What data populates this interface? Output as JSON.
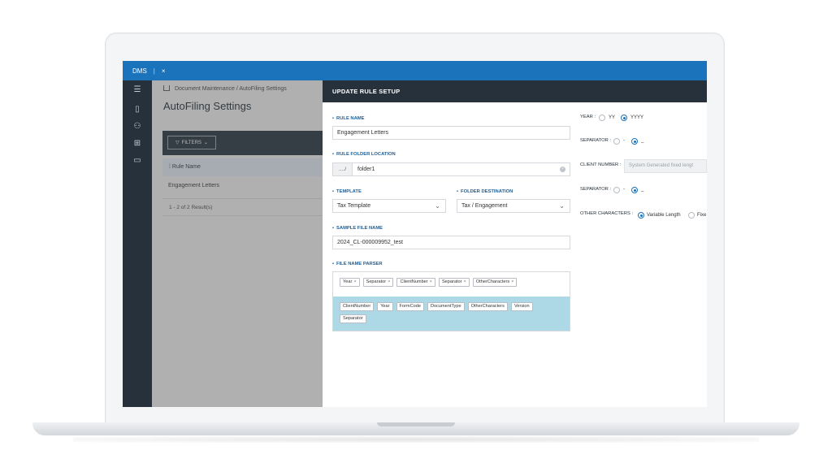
{
  "topbar": {
    "app": "DMS",
    "divider": "|",
    "close": "×"
  },
  "breadcrumb": {
    "items": [
      "Document Maintenance",
      "AutoFiling Settings"
    ],
    "sep": "/"
  },
  "page_title": "AutoFiling Settings",
  "list": {
    "filter_label": "FILTERS",
    "column": "Rule Name",
    "rows": [
      "Engagement Letters"
    ],
    "results": "1 - 2 of 2 Result(s)"
  },
  "panel": {
    "title": "UPDATE RULE SETUP",
    "rule_name": {
      "label": "RULE NAME",
      "value": "Engagement Letters"
    },
    "folder_location": {
      "label": "RULE FOLDER LOCATION",
      "prefix": "..../",
      "value": "folder1"
    },
    "template": {
      "label": "TEMPLATE",
      "value": "Tax Template"
    },
    "folder_destination": {
      "label": "FOLDER DESTINATION",
      "value": "Tax / Engagement"
    },
    "sample_file": {
      "label": "SAMPLE FILE NAME",
      "value": "2024_CL-000009952_test"
    },
    "parser": {
      "label": "FILE NAME PARSER",
      "selected": [
        "Year",
        "Separator",
        "ClientNumber",
        "Separator",
        "OtherCharacters"
      ],
      "available_row1": [
        "ClientNumber",
        "Year",
        "FormCode",
        "DocumentType",
        "OtherCharacters",
        "Version"
      ],
      "available_row2": [
        "Separator"
      ]
    },
    "year": {
      "label": "YEAR :",
      "options": [
        "YY",
        "YYYY"
      ],
      "selected": "YYYY"
    },
    "separator1": {
      "label": "SEPARATOR :",
      "options": [
        "-",
        "_"
      ],
      "selected": "_"
    },
    "client_number": {
      "label": "CLIENT NUMBER :",
      "placeholder": "System Generated fixed lengt"
    },
    "separator2": {
      "label": "SEPARATOR :",
      "options": [
        "-",
        "_"
      ],
      "selected": "_"
    },
    "other_chars": {
      "label": "OTHER CHARACTERS :",
      "options": [
        "Variable Length",
        "Fixe"
      ],
      "selected": "Variable Length"
    }
  },
  "colors": {
    "topbar": "#1a73bb",
    "dark": "#26313b",
    "label": "#1d5f97",
    "parser_bg": "#add8e6"
  }
}
